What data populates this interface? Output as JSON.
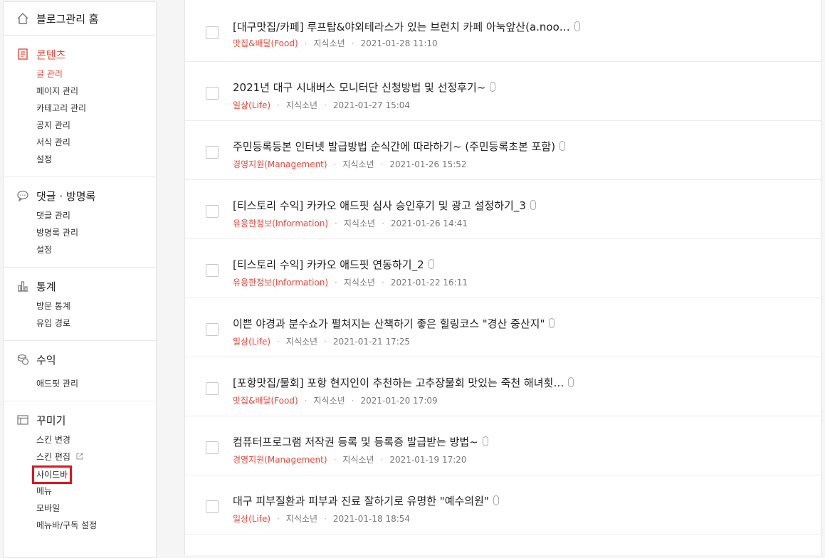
{
  "sidebar": {
    "home_label": "블로그관리 홈",
    "sections": [
      {
        "title": "콘텐츠",
        "icon": "document-icon",
        "items": [
          "글 관리",
          "페이지 관리",
          "카테고리 관리",
          "공지 관리",
          "서식 관리",
          "설정"
        ]
      },
      {
        "title": "댓글 · 방명록",
        "icon": "chat-bubble-icon",
        "items": [
          "댓글 관리",
          "방명록 관리",
          "설정"
        ]
      },
      {
        "title": "통계",
        "icon": "bar-chart-icon",
        "items": [
          "방문 통계",
          "유입 경로"
        ]
      },
      {
        "title": "수익",
        "icon": "coins-icon",
        "items": [
          "애드핏 관리"
        ]
      },
      {
        "title": "꾸미기",
        "icon": "layout-icon",
        "items": [
          "스킨 변경",
          "스킨 편집",
          "사이드바",
          "메뉴",
          "모바일",
          "메뉴바/구독 설정"
        ]
      }
    ]
  },
  "posts": [
    {
      "title": "[대구맛집/카페] 루프탑&야외테라스가 있는 브런치 카페 아눅앞산(a.noo…",
      "category": "맛집&배달(Food)",
      "author": "지식소년",
      "date": "2021-01-28 11:10"
    },
    {
      "title": "2021년 대구 시내버스 모니터단 신청방법 및 선정후기~",
      "category": "일상(Life)",
      "author": "지식소년",
      "date": "2021-01-27 15:04"
    },
    {
      "title": "주민등록등본 인터넷 발급방법 순식간에 따라하기~ (주민등록초본 포함)",
      "category": "경영지원(Management)",
      "author": "지식소년",
      "date": "2021-01-26 15:52"
    },
    {
      "title": "[티스토리 수익] 카카오 애드핏 심사 승인후기 및 광고 설정하기_3",
      "category": "유용한정보(Information)",
      "author": "지식소년",
      "date": "2021-01-26 14:41"
    },
    {
      "title": "[티스토리 수익] 카카오 애드핏 연동하기_2",
      "category": "유용한정보(Information)",
      "author": "지식소년",
      "date": "2021-01-22 16:11"
    },
    {
      "title": "이쁜 야경과 분수쇼가 펼쳐지는 산책하기 좋은 힐링코스 \"경산 중산지\"",
      "category": "일상(Life)",
      "author": "지식소년",
      "date": "2021-01-21 17:25"
    },
    {
      "title": "[포항맛집/물회] 포항 현지인이 추천하는 고추장물회 맛있는 죽천 해녀횟…",
      "category": "맛집&배달(Food)",
      "author": "지식소년",
      "date": "2021-01-20 17:09"
    },
    {
      "title": "컴퓨터프로그램 저작권 등록 및 등록증 발급받는 방법~",
      "category": "경영지원(Management)",
      "author": "지식소년",
      "date": "2021-01-19 17:20"
    },
    {
      "title": "대구 피부질환과 피부과 진료 잘하기로 유명한 \"예수의원\"",
      "category": "일상(Life)",
      "author": "지식소년",
      "date": "2021-01-18 18:54"
    }
  ],
  "colors": {
    "accent": "#e34a3c",
    "highlight_box": "#e3141b"
  }
}
